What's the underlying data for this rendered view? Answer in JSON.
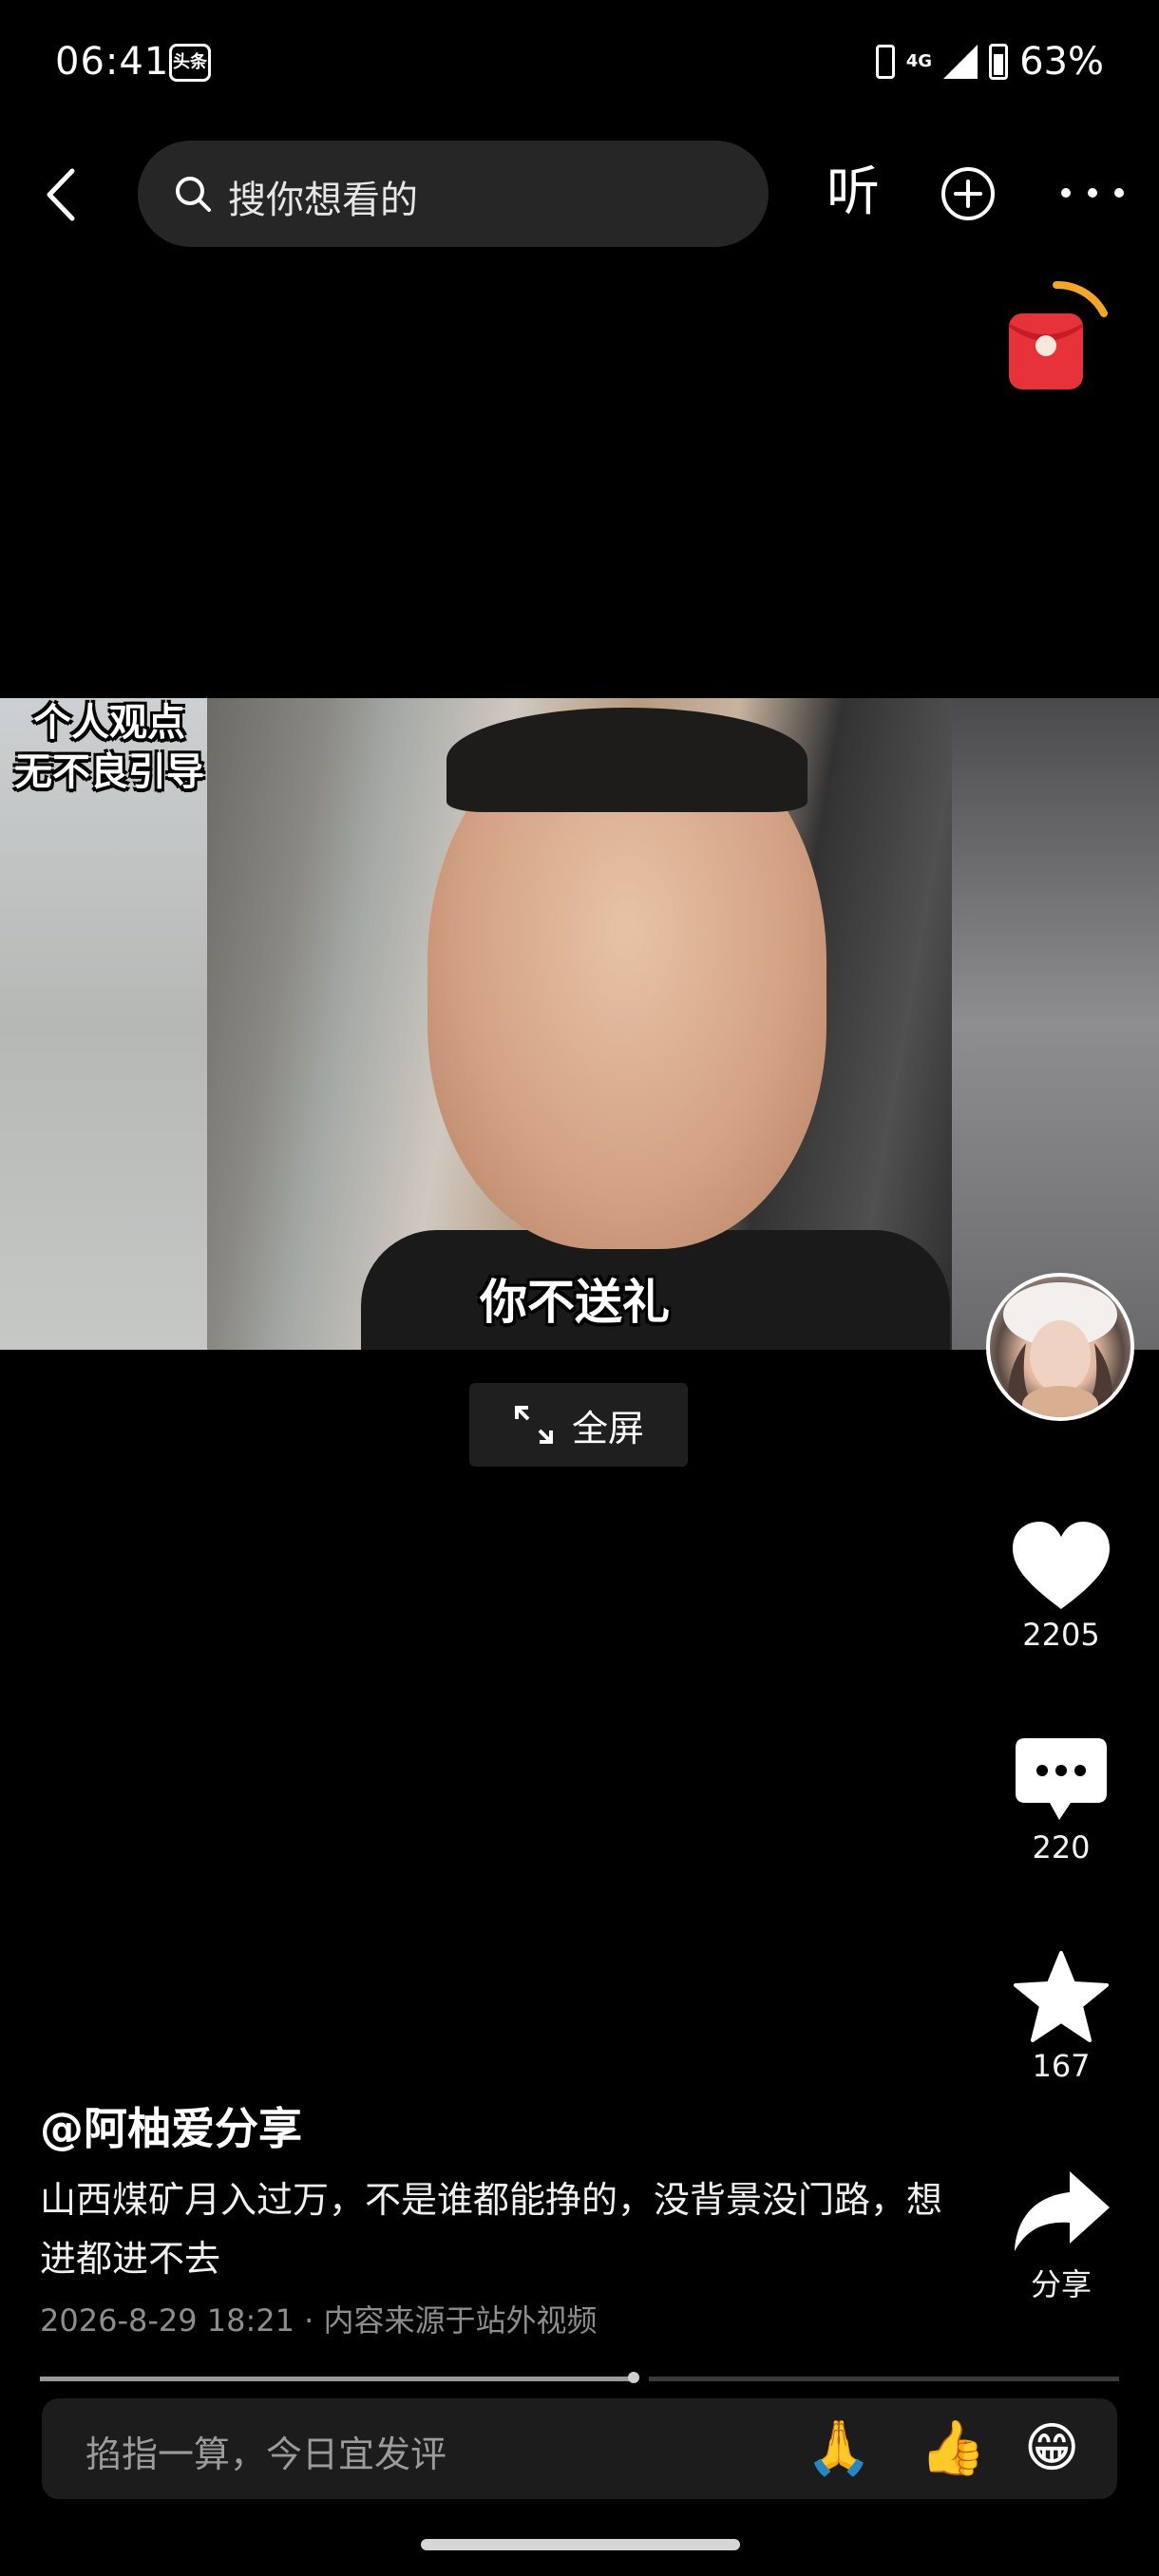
{
  "status_bar": {
    "time": "06:41",
    "app_badge": "头条",
    "network": "4G",
    "battery": "63%",
    "battery_level": 0.63
  },
  "top_bar": {
    "search_placeholder": "搜你想看的",
    "listen_label": "听"
  },
  "video": {
    "overlay_text_line1": "个人观点",
    "overlay_text_line2": "无不良引导",
    "subtitle": "你不送礼",
    "fullscreen_label": "全屏"
  },
  "actions": {
    "like_count": "2205",
    "comment_count": "220",
    "favorite_count": "167",
    "share_label": "分享"
  },
  "post": {
    "author": "@阿柚爱分享",
    "description": "山西煤矿月入过万，不是谁都能挣的，没背景没门路，想进都进不去",
    "meta": "2026-8-29 18:21 · 内容来源于站外视频"
  },
  "playback": {
    "progress": 0.55
  },
  "comment_bar": {
    "placeholder": "掐指一算，今日宜发评",
    "emojis": [
      "🙏",
      "👍",
      "😁"
    ]
  },
  "colors": {
    "background": "#000000",
    "redpacket": "#e8323a",
    "redpacket_ring": "#f5a623"
  }
}
